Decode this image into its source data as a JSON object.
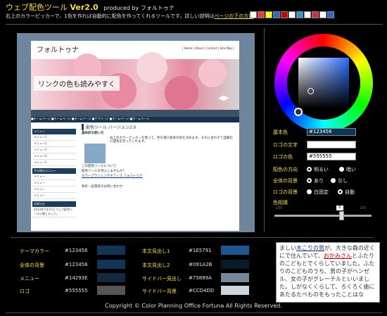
{
  "header": {
    "title": "ウェブ配色ツール",
    "version": "Ver2.0",
    "produced_by": "produced by フォルトゥナ",
    "intro": "右上のカラーピッカーで、1色を作れば自動的に配色を作ってくれるツールです。詳しい説明は",
    "intro_link": "ページの下の方に",
    "intro_end": "。"
  },
  "preview": {
    "logo": "フォルトゥナ",
    "nav": "| Home | About | Contact | Site Map |",
    "hero_text": "リンクの色も読みやすく",
    "arrow_left": "◀",
    "arrow_right": "▶",
    "menu": "■ホームページ   ■ホームページ   ■ホームページ   ■サブページ   ■ホームページ   ■ホームページ",
    "side_head1": "メニュー",
    "side_items1": [
      "メニュー1",
      "メニュー2",
      "メニュー3",
      "メニュー4",
      "メニュー5"
    ],
    "side_head2": "その他のメニュー",
    "side_items2": [
      "メニュー",
      "メニュー",
      "メニュー",
      "メニュー"
    ],
    "side_head3": "お知らせ",
    "side_news": "2013年7月17日 ウェブ配色ツール公開しました。",
    "main_title": "配色ツール バージョン2.0",
    "main_sub1": "基本的な使い方",
    "main_text1": "右上のカラーピッカーを使って、色を選び基本の色を決めます。それに合わせて自動的に配色を作ってくれます。",
    "main_sub2": "この配色ツールについて",
    "main_sub3": "配色ツールを導入しませんか？",
    "main_link": "カラープランニングオフィス フォルトゥナ",
    "main_sub4": "新析・拡張等のお問い合わせ"
  },
  "picker": {
    "base_color_label": "基本色",
    "base_color_value": "#123456",
    "logo_text_label": "ロゴの文字",
    "logo_text_value": "",
    "logo_color_label": "ロゴの色",
    "logo_color_value": "#555555",
    "direction_label": "配色の方向",
    "direction_opt1": "明るい",
    "direction_opt2": "暗い",
    "bg_label": "全体の背景",
    "bg_opt1": "あり",
    "bg_opt2": "なし",
    "logo_bg_label": "ロゴの背景",
    "logo_bg_opt1": "白固定",
    "logo_bg_opt2": "自動",
    "hue_label": "色相環",
    "hue_min": "-180",
    "hue_max": "180",
    "hue_value": "0",
    "hue_level_deg": 0
  },
  "swatches": {
    "left": [
      {
        "label": "テーマカラー",
        "hex": "#123456",
        "color": "#123456"
      },
      {
        "label": "全体の背景",
        "hex": "#123456",
        "color": "#123456"
      },
      {
        "label": "メニュー",
        "hex": "#14293E",
        "color": "#14293E"
      },
      {
        "label": "ロゴ",
        "hex": "#555555",
        "color": "#555555"
      }
    ],
    "right": [
      {
        "label": "本文見出し1",
        "hex": "#1E5791",
        "color": "#1E5791"
      },
      {
        "label": "本文見出し2",
        "hex": "#091A2B",
        "color": "#091A2B"
      },
      {
        "label": "サイドバー見出し",
        "hex": "#75889A",
        "color": "#75889A"
      },
      {
        "label": "サイドバー背景",
        "hex": "#CCD4DD",
        "color": "#CCD4DD"
      }
    ]
  },
  "sample": {
    "t1": "ましい",
    "k1": "木こりの男",
    "t2": "が、大きな森の近くにで住んでいて、",
    "k2": "おかみさん",
    "t3": "とふたりのこどもとでくらしていました。ふたりのこどものうち、男の子がヘンゼル、女の子がグレーテルといいました。しがなくくらして、ろくろく歯にあたるたべものをもったことはな"
  },
  "footer": {
    "copyright": "Copyright © Color Planning Office Fortuna All Rights Reserved."
  },
  "colors": {
    "accent": "#ffde3a",
    "theme": "#123456",
    "panel": "#6f859b"
  }
}
